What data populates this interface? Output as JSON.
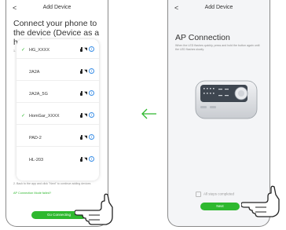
{
  "header": {
    "back_glyph": "<",
    "title": "Add Device"
  },
  "left": {
    "title": "Connect your phone to the device (Device as a hotspot)",
    "step1": "1. Please connect the phone with below the hotspots",
    "networks": [
      {
        "name": "HG_XXXX",
        "checked": true
      },
      {
        "name": "2A2A",
        "checked": false
      },
      {
        "name": "2A2A_5G",
        "checked": false
      },
      {
        "name": "HomGar_XXXX",
        "checked": true
      },
      {
        "name": "PAD-2",
        "checked": false
      },
      {
        "name": "HL-203",
        "checked": false
      }
    ],
    "check_glyph": "✓",
    "step2": "2. Back to the app and click \"Next\" to continue adding devices",
    "failed_link": "AP Connection Mode failed?",
    "button": "Go Connecting"
  },
  "right": {
    "title": "AP Connection",
    "desc": "When the LED flashes quickly, press and hold the button again until the LED flashes slowly.",
    "steps_label": "All steps completed",
    "button": "Next"
  },
  "icons": {
    "arrow": "arrow-left-icon",
    "hand": "pointing-hand-icon",
    "lock": "lock-icon",
    "wifi": "wifi-icon",
    "info": "info-icon"
  },
  "colors": {
    "accent": "#2eb82e",
    "info": "#3a8ee6",
    "arrow": "#2eb82e"
  }
}
